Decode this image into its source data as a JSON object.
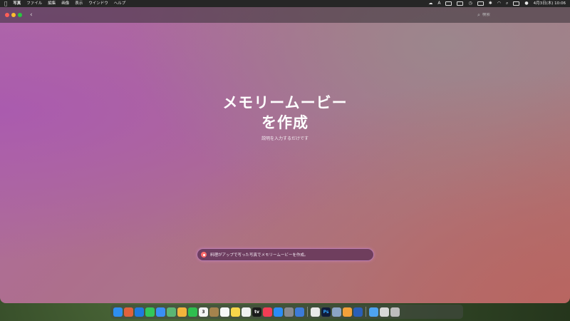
{
  "menubar": {
    "apple": "",
    "items": [
      "写真",
      "ファイル",
      "編集",
      "画像",
      "表示",
      "ウインドウ",
      "ヘルプ"
    ],
    "clock": "4月3日(木) 10:06"
  },
  "window": {
    "search_placeholder": "検索"
  },
  "hero": {
    "title_line1": "メモリームービー",
    "title_line2": "を作成",
    "subtitle": "説明を入力するだけです"
  },
  "prompt": {
    "text": "料理がアップで写った写真でメモリームービーを作成。"
  },
  "colors": {
    "accent": "#ff6b6b",
    "traffic_red": "#ff5f57",
    "traffic_yellow": "#febc2e",
    "traffic_green": "#28c840"
  },
  "dock": {
    "apps": [
      {
        "name": "finder-icon",
        "color": "#2e8ef0"
      },
      {
        "name": "launchpad-icon",
        "color": "#e0623c"
      },
      {
        "name": "safari-icon",
        "color": "#1f7ae0"
      },
      {
        "name": "messages-icon",
        "color": "#33c759"
      },
      {
        "name": "mail-icon",
        "color": "#3a8ff5"
      },
      {
        "name": "maps-icon",
        "color": "#5bb574"
      },
      {
        "name": "photos-icon",
        "color": "#f3b43c"
      },
      {
        "name": "facetime-icon",
        "color": "#2fbf4f"
      },
      {
        "name": "calendar-icon",
        "color": "#f4f4f4"
      },
      {
        "name": "contacts-icon",
        "color": "#a5834d"
      },
      {
        "name": "reminders-icon",
        "color": "#f7f7f7"
      },
      {
        "name": "notes-icon",
        "color": "#f7d64a"
      },
      {
        "name": "freeform-icon",
        "color": "#f0f0f0"
      },
      {
        "name": "appletv-icon",
        "color": "#1b1b1b"
      },
      {
        "name": "music-icon",
        "color": "#f23d55"
      },
      {
        "name": "appstore-icon",
        "color": "#2b8cf5"
      },
      {
        "name": "settings-icon",
        "color": "#8a8a8f"
      },
      {
        "name": "xcode-icon",
        "color": "#3d7bd8"
      },
      {
        "name": "chrome-icon",
        "color": "#e9e9e9"
      },
      {
        "name": "photoshop-icon",
        "color": "#0f1c3a"
      },
      {
        "name": "preview-icon",
        "color": "#8ba4c4"
      },
      {
        "name": "pages-icon",
        "color": "#f3a13a"
      },
      {
        "name": "word-icon",
        "color": "#2a5fb8"
      },
      {
        "name": "folder-icon",
        "color": "#4ea3f0"
      },
      {
        "name": "screenshot-icon",
        "color": "#d8d8d8"
      },
      {
        "name": "trash-icon",
        "color": "#bdbdbd"
      }
    ],
    "calendar_day": "3",
    "photoshop_label": "Ps",
    "appletv_label": "tv"
  }
}
